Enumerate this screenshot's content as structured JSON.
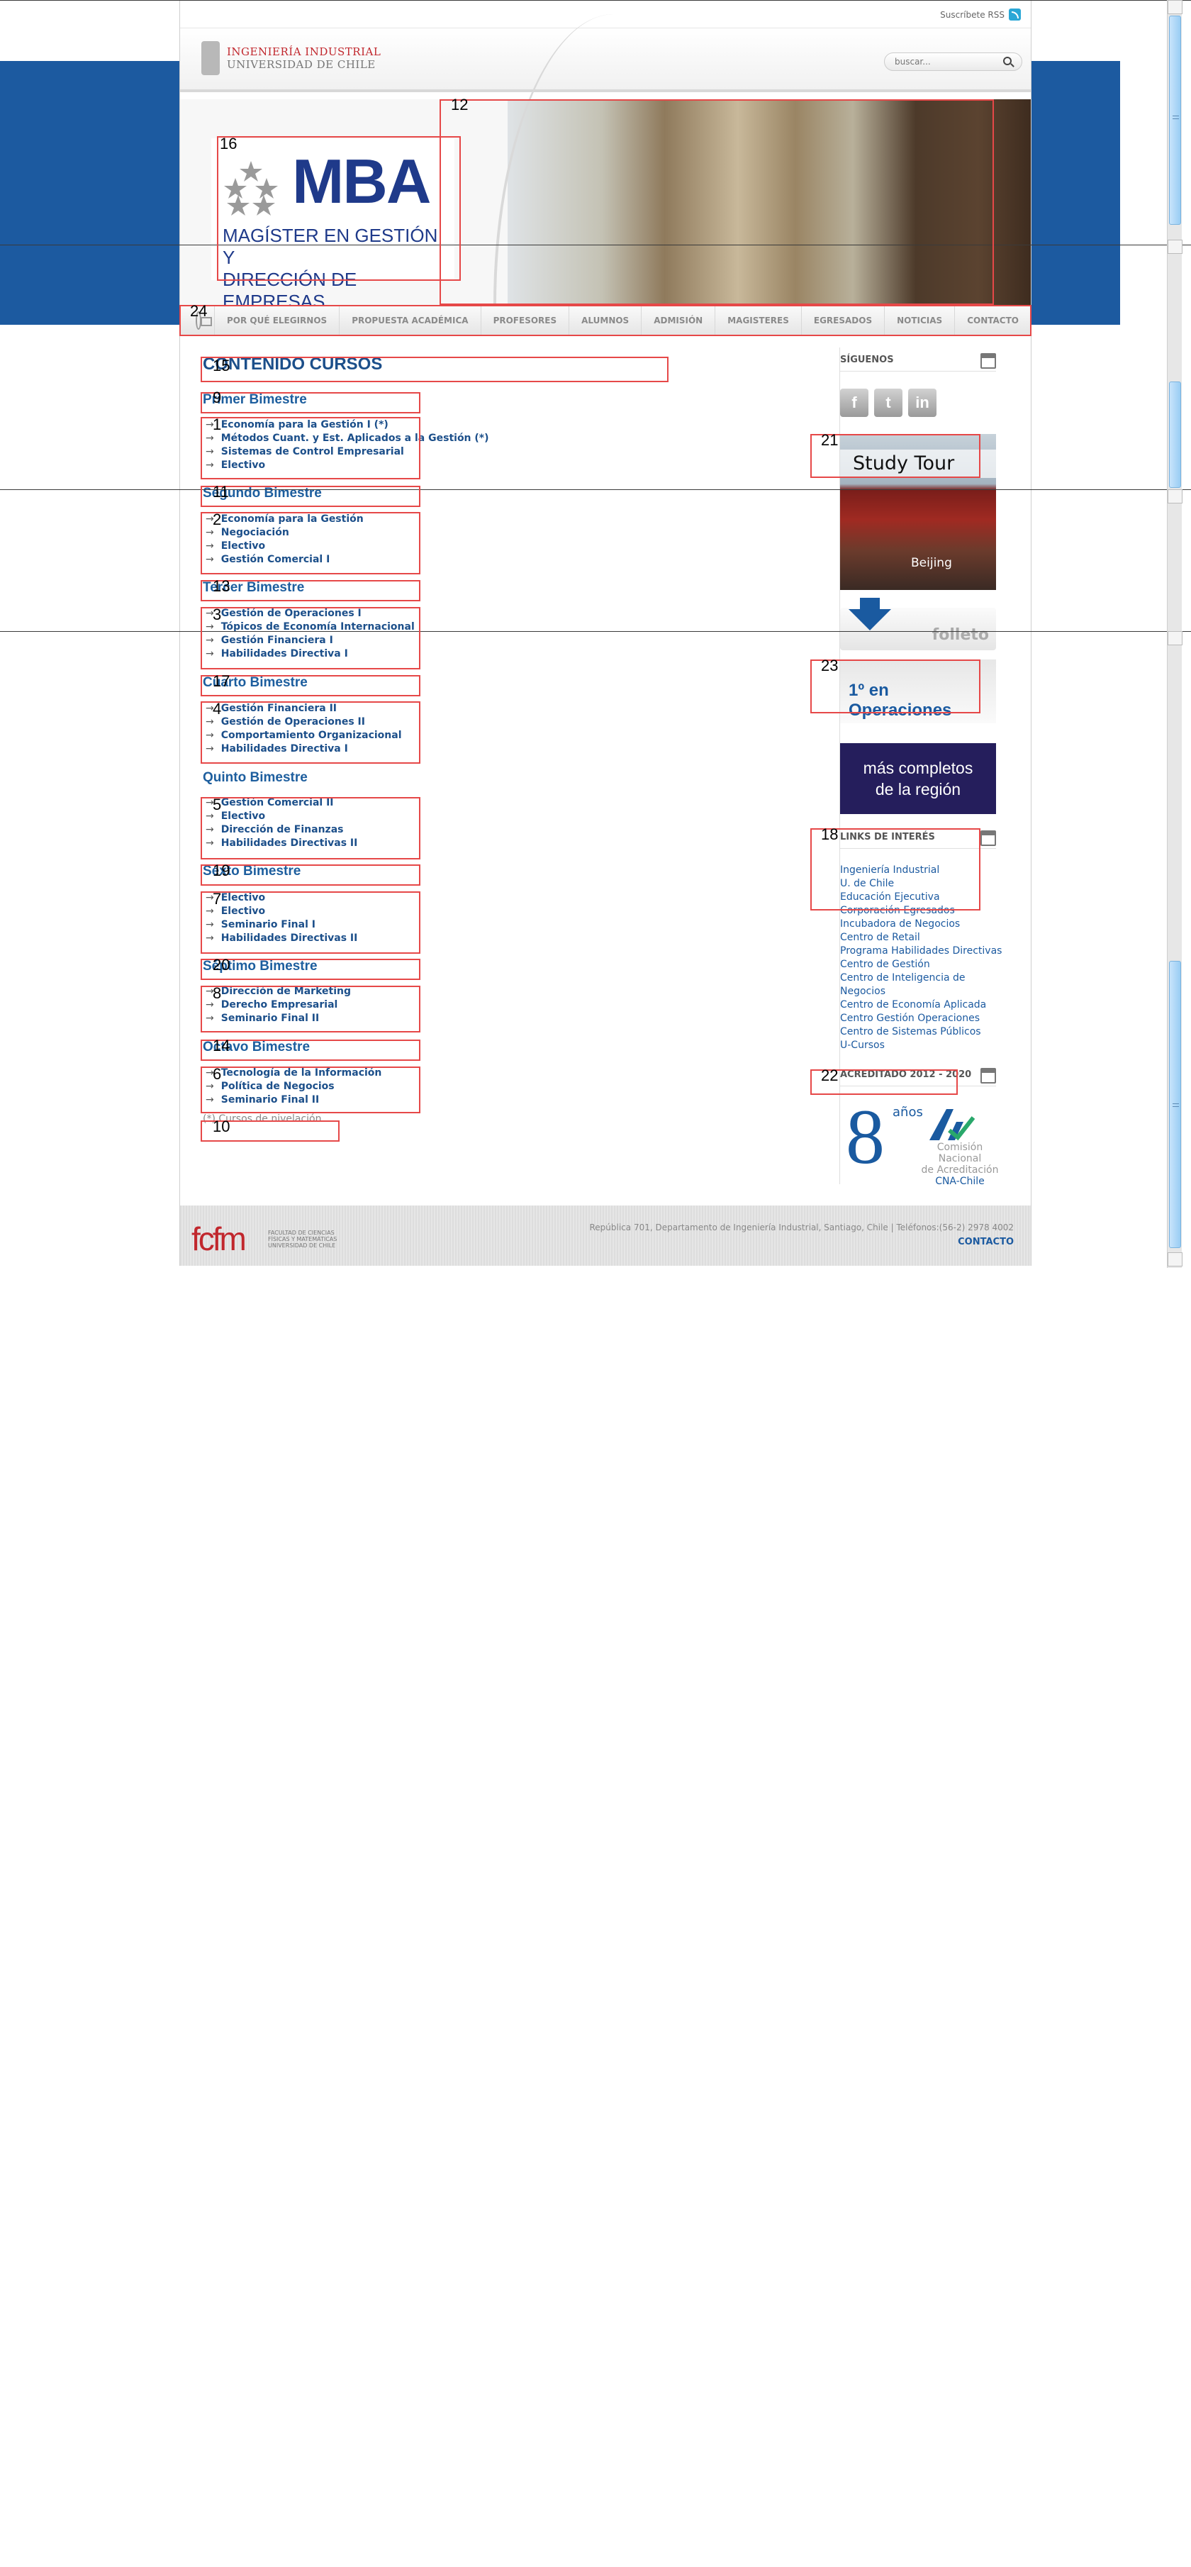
{
  "top": {
    "rss_label": "Suscríbete RSS"
  },
  "header": {
    "logo_line1": "INGENIERÍA INDUSTRIAL",
    "logo_line2": "UNIVERSIDAD DE CHILE",
    "search_placeholder": "buscar..."
  },
  "banner": {
    "mba_title": "MBA",
    "mba_subtitle_1": "MAGÍSTER EN GESTIÓN Y",
    "mba_subtitle_2": "DIRECCIÓN DE EMPRESAS"
  },
  "nav": {
    "items": [
      "POR QUÉ ELEGIRNOS",
      "PROPUESTA ACADÉMICA",
      "PROFESORES",
      "ALUMNOS",
      "ADMISIÓN",
      "MAGISTERES",
      "EGRESADOS",
      "NOTICIAS",
      "CONTACTO"
    ]
  },
  "content": {
    "title": "CONTENIDO CURSOS",
    "bimestres": [
      {
        "title": "Primer Bimestre",
        "courses": [
          "Economía para la Gestión I (*)",
          "Métodos Cuant. y Est. Aplicados a la Gestión (*)",
          "Sistemas de Control Empresarial",
          "Electivo"
        ]
      },
      {
        "title": "Segundo Bimestre",
        "courses": [
          "Economía para la Gestión",
          "Negociación",
          "Electivo",
          "Gestión Comercial I"
        ]
      },
      {
        "title": "Tercer Bimestre",
        "courses": [
          "Gestión de Operaciones I",
          "Tópicos de Economía Internacional",
          "Gestión Financiera I",
          "Habilidades Directiva I"
        ]
      },
      {
        "title": "Cuarto Bimestre",
        "courses": [
          "Gestión Financiera II",
          "Gestión de Operaciones II",
          "Comportamiento Organizacional",
          "Habilidades Directiva I"
        ]
      },
      {
        "title": "Quinto Bimestre",
        "courses": [
          "Gestión Comercial II",
          "Electivo",
          "Dirección de Finanzas",
          "Habilidades Directivas II"
        ]
      },
      {
        "title": "Sexto Bimestre",
        "courses": [
          "Electivo",
          "Electivo",
          "Seminario Final I",
          "Habilidades Directivas II"
        ]
      },
      {
        "title": "Séptimo Bimestre",
        "courses": [
          "Dirección de Marketing",
          "Derecho Empresarial",
          "Seminario Final II"
        ]
      },
      {
        "title": "Octavo Bimestre",
        "courses": [
          "Tecnología de la Información",
          "Política de Negocios",
          "Seminario Final II"
        ]
      }
    ],
    "note": "(*) Cursos de nivelación"
  },
  "sidebar": {
    "follow_title": "SÍGUENOS",
    "social": [
      "f",
      "t",
      "in"
    ],
    "study_tour": "Study Tour",
    "study_city": "Beijing",
    "folleto": "folleto",
    "operaciones": "1º en Operaciones",
    "region_1": "más completos",
    "region_2": "de la región",
    "links_title": "LINKS DE INTERÉS",
    "links": [
      "Ingeniería Industrial",
      "U. de Chile",
      "Educación Ejecutiva",
      "Corporación Egresados",
      "Incubadora de Negocios",
      "Centro de Retail",
      "Programa Habilidades Directivas",
      "Centro de Gestión",
      "Centro de Inteligencia de Negocios",
      "Centro de Economía Aplicada",
      "Centro Gestión Operaciones",
      "Centro de Sistemas Públicos",
      "U-Cursos"
    ],
    "acred_title": "ACREDITADO 2012 - 2020",
    "acred_years": "8",
    "acred_word": "años",
    "cna_1": "Comisión Nacional",
    "cna_2": "de Acreditación",
    "cna_3": "CNA-Chile"
  },
  "footer": {
    "logo": "fcfm",
    "logo_sub": "FACULTAD DE CIENCIAS FÍSICAS Y MATEMÁTICAS UNIVERSIDAD DE CHILE",
    "address": "República 701, Departamento de Ingeniería Industrial, Santiago, Chile | Teléfonos:(56-2) 2978 4002",
    "contact": "CONTACTO"
  },
  "labels": [
    "24",
    "15",
    "9",
    "1",
    "11",
    "2",
    "13",
    "3",
    "17",
    "4",
    "5",
    "19",
    "7",
    "20",
    "8",
    "14",
    "6",
    "10",
    "16",
    "12",
    "21",
    "23",
    "18",
    "22"
  ],
  "colors": {
    "brand_blue": "#1c5aa0",
    "annotation_red": "#e64848"
  }
}
